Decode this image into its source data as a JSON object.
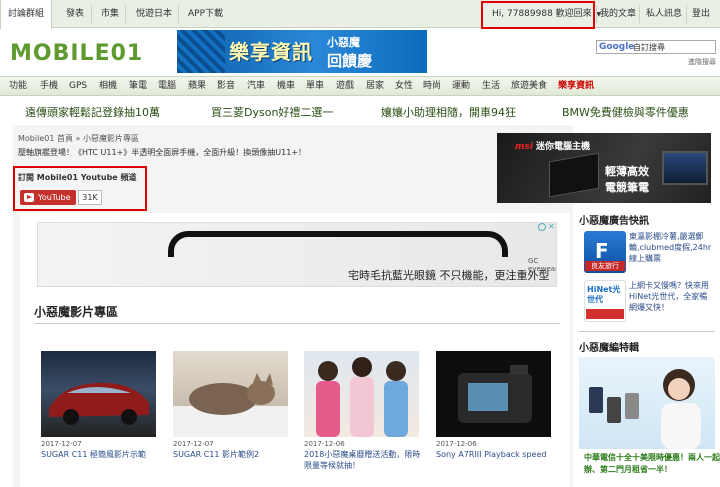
{
  "topbar": {
    "tabs": [
      "討論群組",
      "發表",
      "市集",
      "悅遊日本",
      "APP下載"
    ],
    "greeting": "Hi, 77889988 歡迎回來",
    "links": [
      "我的文章",
      "私人訊息",
      "登出"
    ]
  },
  "header": {
    "logo_text": "MOBILE01",
    "banner": {
      "main": "樂享資訊",
      "brand": "小惡魔",
      "sub": "回饋慶"
    },
    "search": {
      "brand": "Google",
      "placeholder": "自訂搜尋"
    },
    "advanced_search": "進階搜尋"
  },
  "nav": {
    "items": [
      "功能",
      "手機",
      "GPS",
      "相機",
      "筆電",
      "電腦",
      "蘋果",
      "影音",
      "汽車",
      "機車",
      "單車",
      "遊戲",
      "居家",
      "女性",
      "時尚",
      "運動",
      "生活",
      "旅遊美食",
      "樂享資訊"
    ],
    "highlight": "樂享資訊"
  },
  "promo": [
    "遠傳頭家輕鬆記登錄抽10萬",
    "買三菱Dyson好禮二選一",
    "孃孃小助理相隨，開車94狂",
    "BMW免費健檢與零件優惠"
  ],
  "main": {
    "breadcrumb": "Mobile01 首頁 » 小惡魔影片專區",
    "subtitle": "壓軸旗艦登場！《HTC U11+》半透明全面屏手機，全面升級！換頭像抽U11+！",
    "youtube": {
      "title": "訂閱 Mobile01 Youtube 頻道",
      "button": "YouTube",
      "count": "31K"
    },
    "right_ad": {
      "brand": "msi",
      "brand_text": "迷你電腦主機",
      "line1": "輕薄高效",
      "line2": "電競筆電"
    },
    "glasses_ad": {
      "text": "宅時毛抗藍光眼鏡 不只機能，更注重外型",
      "brand": "GC eyewear"
    },
    "section_title": "小惡魔影片專區",
    "videos": [
      {
        "date": "2017-12-07",
        "title": "SUGAR C11 極簡風影片示範"
      },
      {
        "date": "2017-12-07",
        "title": "SUGAR C11 影片範例2"
      },
      {
        "date": "2017-12-06",
        "title": "2018小惡魔桌曆贈送活動，限時限量等候就抽！"
      },
      {
        "date": "2017-12-06",
        "title": "Sony A7RIII Playback speed"
      }
    ]
  },
  "sidebar": {
    "title1": "小惡魔廣告快訊",
    "items": [
      {
        "icon_label": "良友旅行",
        "text": "東瀛影棚冷薯,嚴選郵輪,clubmed度假,24hr線上購票"
      },
      {
        "icon_label": "HiNet光世代",
        "text": "上網卡又慢嗎？快來用HiNet光世代，全家暢網爆又快！"
      }
    ],
    "title2": "小惡魔編特輯",
    "feature_text": "中華電信十全十美限時優惠！兩人一起辦、第二門月租省一半！"
  },
  "colors": {
    "accent_red": "#d00",
    "youtube_red": "#c4302b",
    "link_blue": "#2b4d8a",
    "nav_green": "#e9efe4"
  }
}
